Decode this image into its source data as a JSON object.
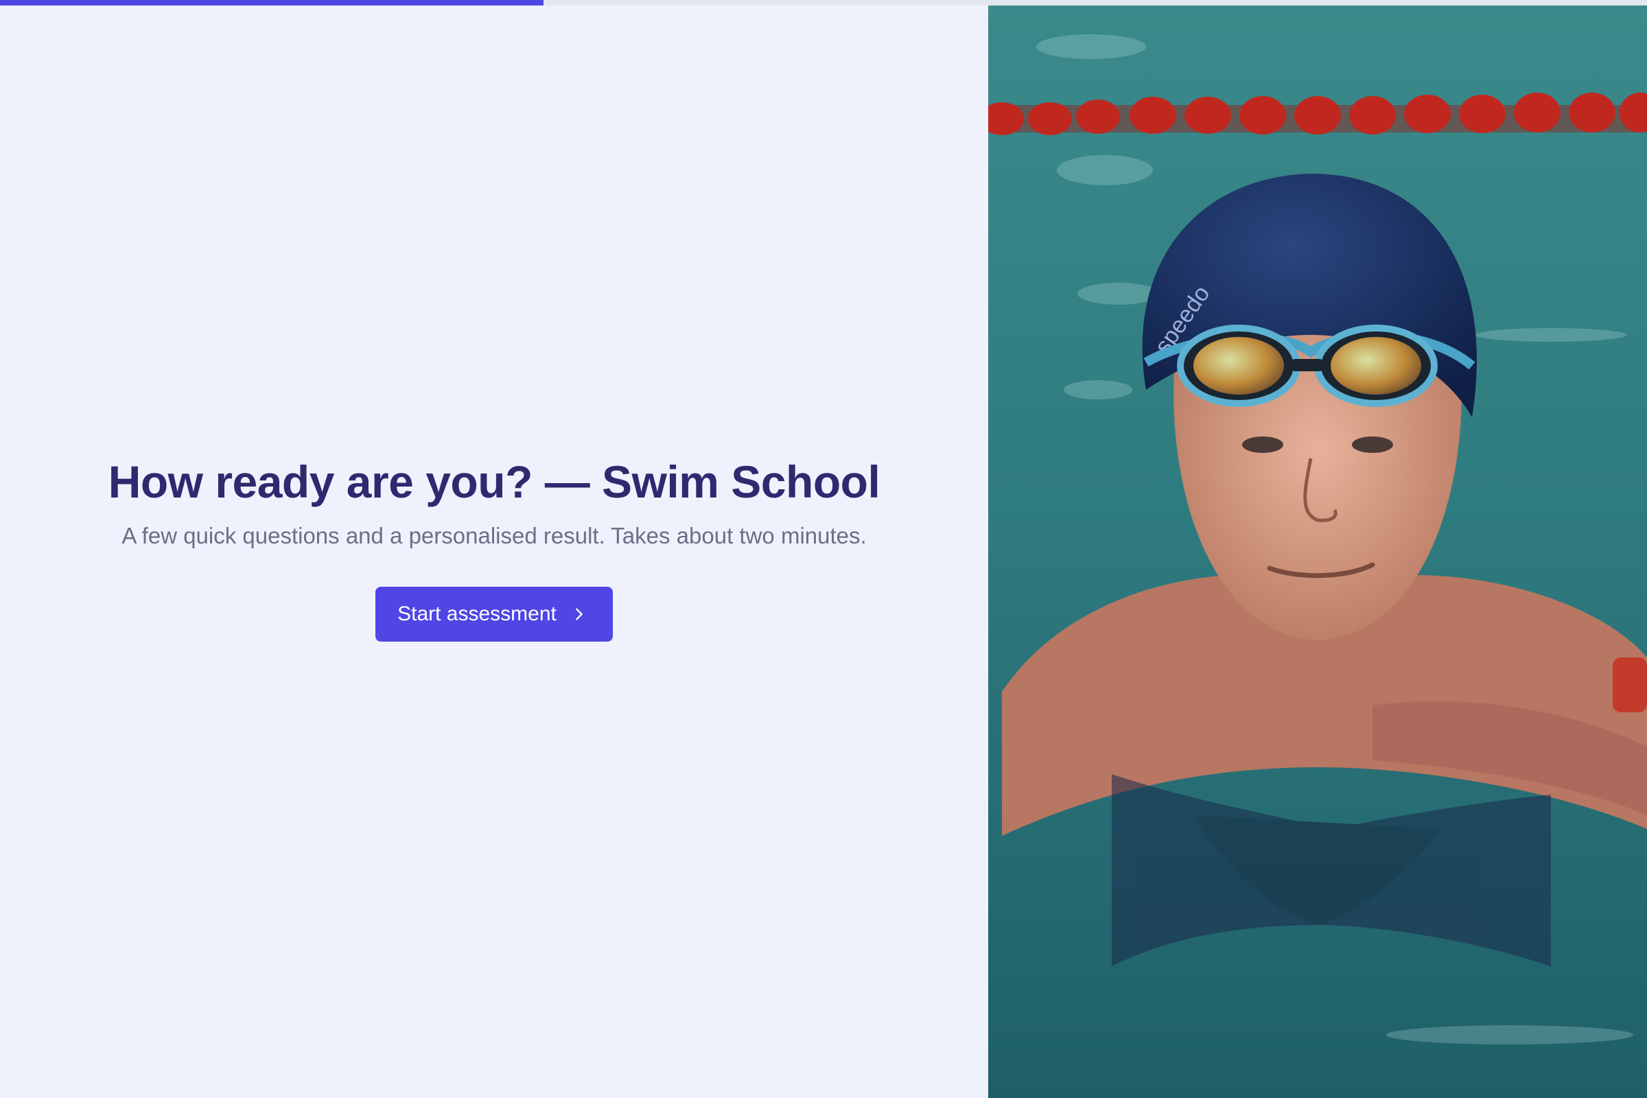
{
  "progress": {
    "fraction": 0.33,
    "track_color": "#e4e6ef",
    "fill_color": "#4f46e5"
  },
  "intro": {
    "title": "How ready are you? — Swim School",
    "subtitle": "A few quick questions and a personalised result. Takes about two minutes.",
    "start_button_label": "Start assessment",
    "start_button_icon": "chevron-right-icon"
  },
  "hero_image": {
    "cap_text": "speedo"
  },
  "colors": {
    "page_bg": "#eff2fc",
    "title": "#2e2a6f",
    "subtitle": "#6a6f86",
    "accent": "#4f46e5",
    "pool_water": "#2f7f84",
    "lane_rope": "#c0281f",
    "swim_cap": "#142a5c"
  }
}
